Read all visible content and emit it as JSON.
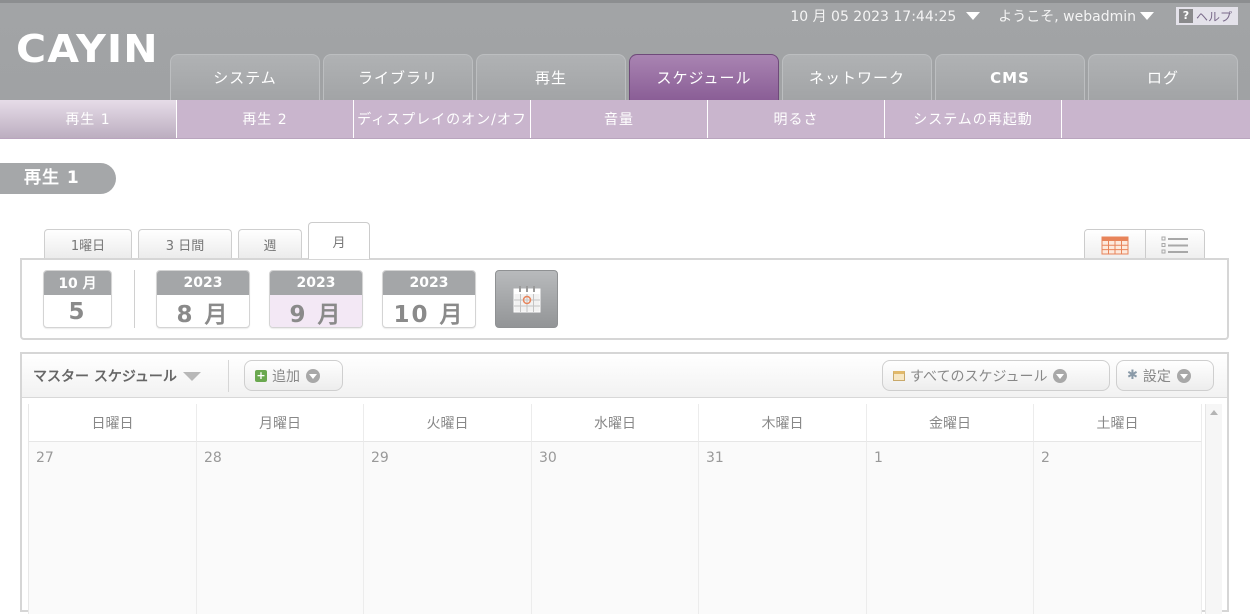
{
  "header": {
    "logo": "CAYIN",
    "datetime": "10 月 05 2023 17:44:25",
    "welcome": "ようこそ, webadmin",
    "help_label": "ヘルプ",
    "help_mark": "?"
  },
  "main_tabs": [
    {
      "label": "システム"
    },
    {
      "label": "ライブラリ"
    },
    {
      "label": "再生"
    },
    {
      "label": "スケジュール",
      "active": true
    },
    {
      "label": "ネットワーク"
    },
    {
      "label": "CMS"
    },
    {
      "label": "ログ"
    }
  ],
  "sub_tabs": [
    {
      "label": "再生 1",
      "active": true
    },
    {
      "label": "再生 2"
    },
    {
      "label": "ディスプレイのオン/オフ"
    },
    {
      "label": "音量"
    },
    {
      "label": "明るさ"
    },
    {
      "label": "システムの再起動"
    }
  ],
  "page_title": "再生 1",
  "view_tabs": [
    {
      "label": "1曜日"
    },
    {
      "label": "3 日間"
    },
    {
      "label": "週"
    },
    {
      "label": "月",
      "active": true
    }
  ],
  "view_switch": [
    "calendar-grid-icon",
    "list-view-icon"
  ],
  "date_nav": {
    "today": {
      "top": "10 月",
      "bottom": "5"
    },
    "months": [
      {
        "year": "2023",
        "month": "8 月"
      },
      {
        "year": "2023",
        "month": "9 月",
        "selected": true
      },
      {
        "year": "2023",
        "month": "10 月"
      }
    ]
  },
  "toolbar": {
    "master_schedule": "マスター スケジュール",
    "add_label": "追加",
    "all_schedules_label": "すべてのスケジュール",
    "settings_label": "設定",
    "add_icon": "+"
  },
  "calendar": {
    "weekdays": [
      "日曜日",
      "月曜日",
      "火曜日",
      "水曜日",
      "木曜日",
      "金曜日",
      "土曜日"
    ],
    "first_row_dates": [
      "27",
      "28",
      "29",
      "30",
      "31",
      "1",
      "2"
    ]
  },
  "colors": {
    "header_bg": "#a2a4a6",
    "active_tab": "#8a5e96",
    "subnav_bg": "#c9b5cd",
    "selected_month_bg": "#f3e8f5",
    "calendar_icon_accent": "#e8845a"
  }
}
